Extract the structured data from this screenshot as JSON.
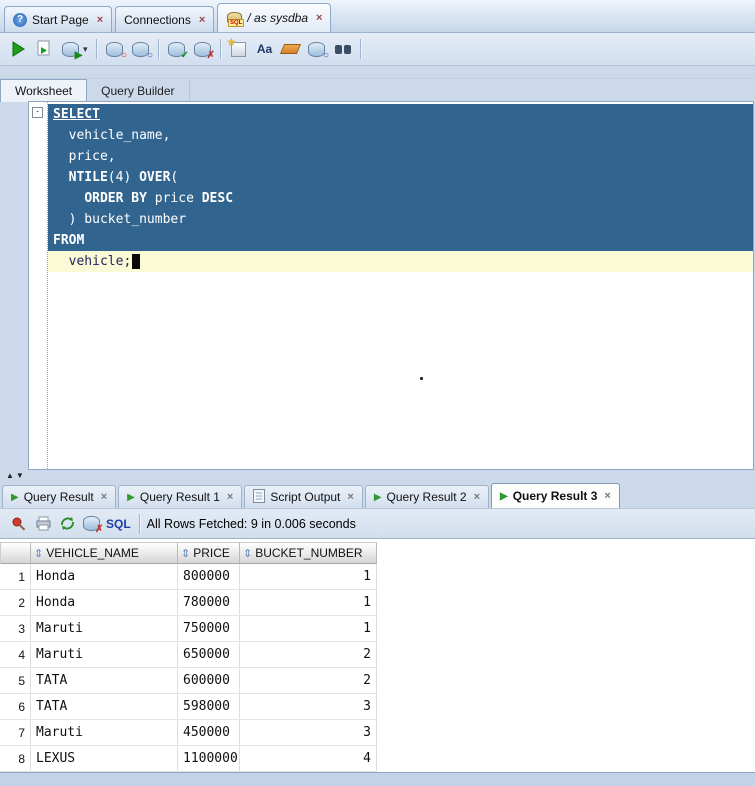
{
  "icons": {
    "close": "×",
    "question": "?",
    "dropdown": "▾",
    "play": "▶",
    "sort": "⇕",
    "check": "✓",
    "cross": "✗",
    "star": "★",
    "circle": "○",
    "up": "▲",
    "down": "▼",
    "aa": "Aa",
    "minus": "-",
    "pipe": "|"
  },
  "window_tabs": [
    {
      "label": "Start Page"
    },
    {
      "label": "Connections"
    },
    {
      "label": "/ as sysdba"
    }
  ],
  "worksheet_tabs": [
    {
      "label": "Worksheet"
    },
    {
      "label": "Query Builder"
    }
  ],
  "editor": {
    "lines": [
      {
        "segments": [
          {
            "t": "SELECT",
            "k": true,
            "u": true
          }
        ]
      },
      {
        "segments": [
          {
            "t": "  vehicle_name,"
          }
        ]
      },
      {
        "segments": [
          {
            "t": "  price,"
          }
        ]
      },
      {
        "segments": [
          {
            "t": "  "
          },
          {
            "t": "NTILE",
            "k": true
          },
          {
            "t": "(4) "
          },
          {
            "t": "OVER",
            "k": true
          },
          {
            "t": "("
          }
        ]
      },
      {
        "segments": [
          {
            "t": "    "
          },
          {
            "t": "ORDER BY",
            "k": true
          },
          {
            "t": " price "
          },
          {
            "t": "DESC",
            "k": true
          }
        ]
      },
      {
        "segments": [
          {
            "t": "  ) bucket_number"
          }
        ]
      },
      {
        "segments": [
          {
            "t": "FROM",
            "k": true
          }
        ]
      },
      {
        "segments": [
          {
            "t": "  vehicle;"
          }
        ],
        "current": true,
        "caret": true
      }
    ]
  },
  "result_tabs": [
    {
      "label": "Query Result"
    },
    {
      "label": "Query Result 1"
    },
    {
      "label": "Script Output"
    },
    {
      "label": "Query Result 2"
    },
    {
      "label": "Query Result 3"
    }
  ],
  "results_toolbar": {
    "sql_label": "SQL",
    "status": "All Rows Fetched: 9 in 0.006 seconds"
  },
  "grid": {
    "columns": [
      "VEHICLE_NAME",
      "PRICE",
      "BUCKET_NUMBER"
    ],
    "rows": [
      [
        "1",
        "Honda",
        "800000",
        "1"
      ],
      [
        "2",
        "Honda",
        "780000",
        "1"
      ],
      [
        "3",
        "Maruti",
        "750000",
        "1"
      ],
      [
        "4",
        "Maruti",
        "650000",
        "2"
      ],
      [
        "5",
        "TATA",
        "600000",
        "2"
      ],
      [
        "6",
        "TATA",
        "598000",
        "3"
      ],
      [
        "7",
        "Maruti",
        "450000",
        "3"
      ],
      [
        "8",
        "LEXUS",
        "1100000",
        "4"
      ]
    ]
  }
}
